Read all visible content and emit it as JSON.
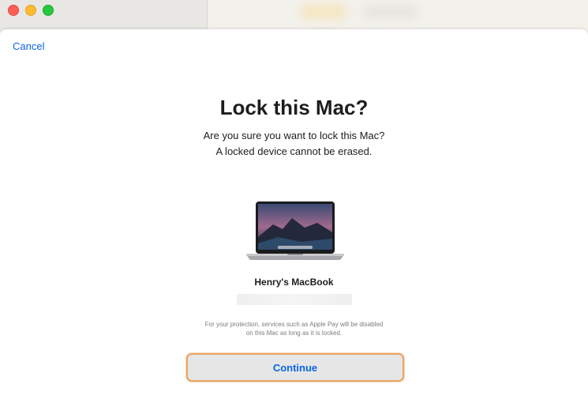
{
  "window": {
    "controls": [
      "close",
      "minimize",
      "zoom"
    ]
  },
  "sheet": {
    "cancel_label": "Cancel",
    "title": "Lock this Mac?",
    "subtitle_line1": "Are you sure you want to lock this Mac?",
    "subtitle_line2": "A locked device cannot be erased.",
    "device": {
      "icon": "macbook-icon",
      "name": "Henry's MacBook"
    },
    "protection_line1": "For your protection, services such as Apple Pay will be disabled",
    "protection_line2": "on this Mac as long as it is locked.",
    "continue_label": "Continue"
  },
  "colors": {
    "accent": "#0a66e6",
    "focus_ring": "#e8a76a",
    "close": "#fe5f57",
    "minimize": "#febc2e",
    "zoom": "#28c840"
  }
}
